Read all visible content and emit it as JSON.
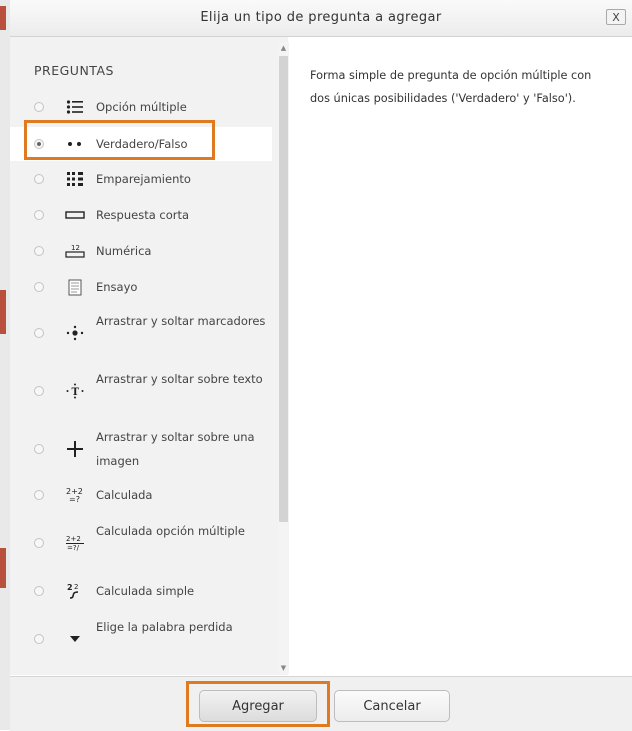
{
  "dialog": {
    "title": "Elija un tipo de pregunta a agregar",
    "close_label": "X"
  },
  "list": {
    "header": "PREGUNTAS",
    "selected_index": 1,
    "items": [
      {
        "label": "Opción múltiple",
        "icon": "multichoice-list-icon",
        "glyph": "⋮☰"
      },
      {
        "label": "Verdadero/Falso",
        "icon": "true-false-dots-icon",
        "glyph": "• •"
      },
      {
        "label": "Emparejamiento",
        "icon": "matching-grid-icon",
        "glyph": "⣿"
      },
      {
        "label": "Respuesta corta",
        "icon": "short-answer-box-icon",
        "glyph": "▭"
      },
      {
        "label": "Numérica",
        "icon": "numerical-12-icon",
        "glyph": "¹²"
      },
      {
        "label": "Ensayo",
        "icon": "essay-document-icon",
        "glyph": "▤"
      },
      {
        "label": "Arrastrar y soltar marcadores",
        "icon": "drag-drop-markers-icon",
        "glyph": "·⁘·"
      },
      {
        "label": "Arrastrar y soltar sobre texto",
        "icon": "drag-drop-text-icon",
        "glyph": "·T·"
      },
      {
        "label": "Arrastrar y soltar sobre una imagen",
        "icon": "drag-drop-image-cross-icon",
        "glyph": "✛"
      },
      {
        "label": "Calculada",
        "icon": "calculated-formula-icon",
        "glyph": "²⁺²₌?"
      },
      {
        "label": "Calculada opción múltiple",
        "icon": "calculated-multichoice-icon",
        "glyph": "²⁺²"
      },
      {
        "label": "Calculada simple",
        "icon": "calculated-simple-icon",
        "glyph": "ᵃ²"
      },
      {
        "label": "Elige la palabra perdida",
        "icon": "dropdown-triangle-icon",
        "glyph": "▼"
      }
    ]
  },
  "description": "Forma simple de pregunta de opción múltiple con dos únicas posibilidades ('Verdadero' y 'Falso').",
  "buttons": {
    "add_label": "Agregar",
    "cancel_label": "Cancelar"
  },
  "colors": {
    "highlight": "#e07a20",
    "list_bg": "#f2f2f2"
  }
}
